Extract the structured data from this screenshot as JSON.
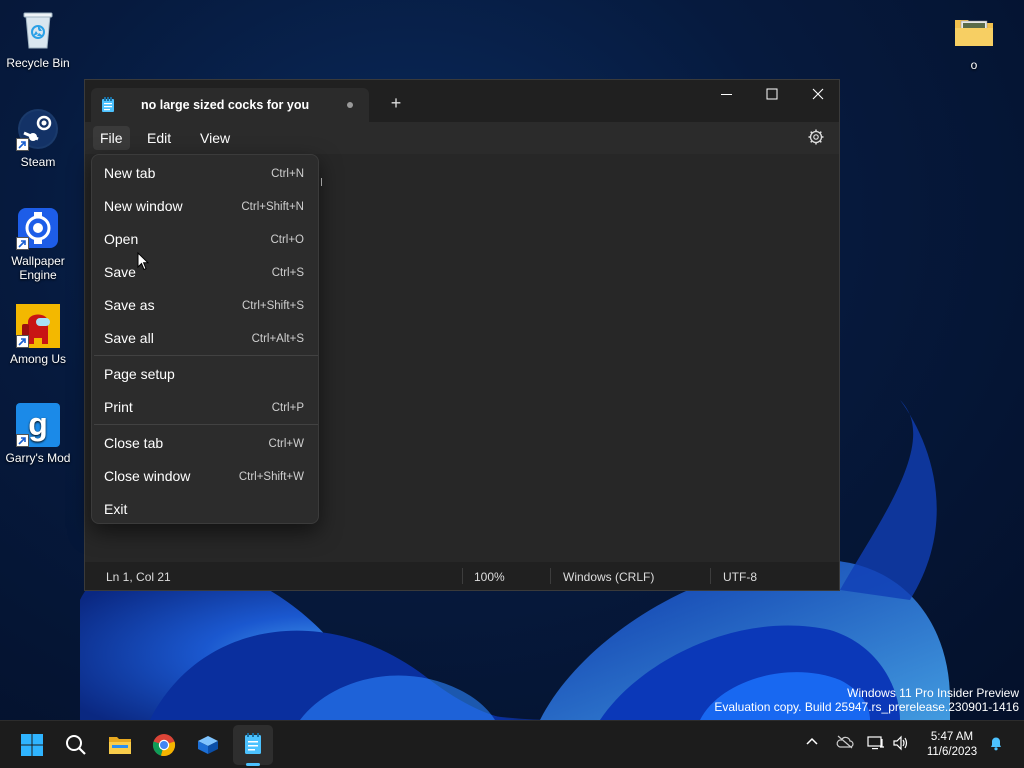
{
  "desktop": {
    "icons": [
      {
        "label": "Recycle Bin"
      },
      {
        "label": "Steam"
      },
      {
        "label": "Wallpaper Engine"
      },
      {
        "label": "Among Us"
      },
      {
        "label": "Garry's Mod"
      },
      {
        "label": "o"
      }
    ]
  },
  "notepad": {
    "tab_title": "no large sized cocks for you",
    "new_tab_symbol": "+",
    "menu": {
      "file": "File",
      "edit": "Edit",
      "view": "View"
    },
    "status": {
      "position": "Ln 1, Col 21",
      "zoom": "100%",
      "line_ending": "Windows (CRLF)",
      "encoding": "UTF-8"
    }
  },
  "file_menu": {
    "items": [
      {
        "label": "New tab",
        "shortcut": "Ctrl+N"
      },
      {
        "label": "New window",
        "shortcut": "Ctrl+Shift+N"
      },
      {
        "label": "Open",
        "shortcut": "Ctrl+O"
      },
      {
        "label": "Save",
        "shortcut": "Ctrl+S"
      },
      {
        "label": "Save as",
        "shortcut": "Ctrl+Shift+S"
      },
      {
        "label": "Save all",
        "shortcut": "Ctrl+Alt+S"
      },
      {
        "label": "Page setup",
        "shortcut": ""
      },
      {
        "label": "Print",
        "shortcut": "Ctrl+P"
      },
      {
        "label": "Close tab",
        "shortcut": "Ctrl+W"
      },
      {
        "label": "Close window",
        "shortcut": "Ctrl+Shift+W"
      },
      {
        "label": "Exit",
        "shortcut": ""
      }
    ]
  },
  "watermark": {
    "line1": "Windows 11 Pro Insider Preview",
    "line2": "Evaluation copy. Build 25947.rs_prerelease.230901-1416"
  },
  "clock": {
    "time": "5:47 AM",
    "date": "11/6/2023"
  },
  "colors": {
    "accent": "#4cc2ff",
    "window_bg": "#202020",
    "menu_bg": "#2c2c2c"
  }
}
